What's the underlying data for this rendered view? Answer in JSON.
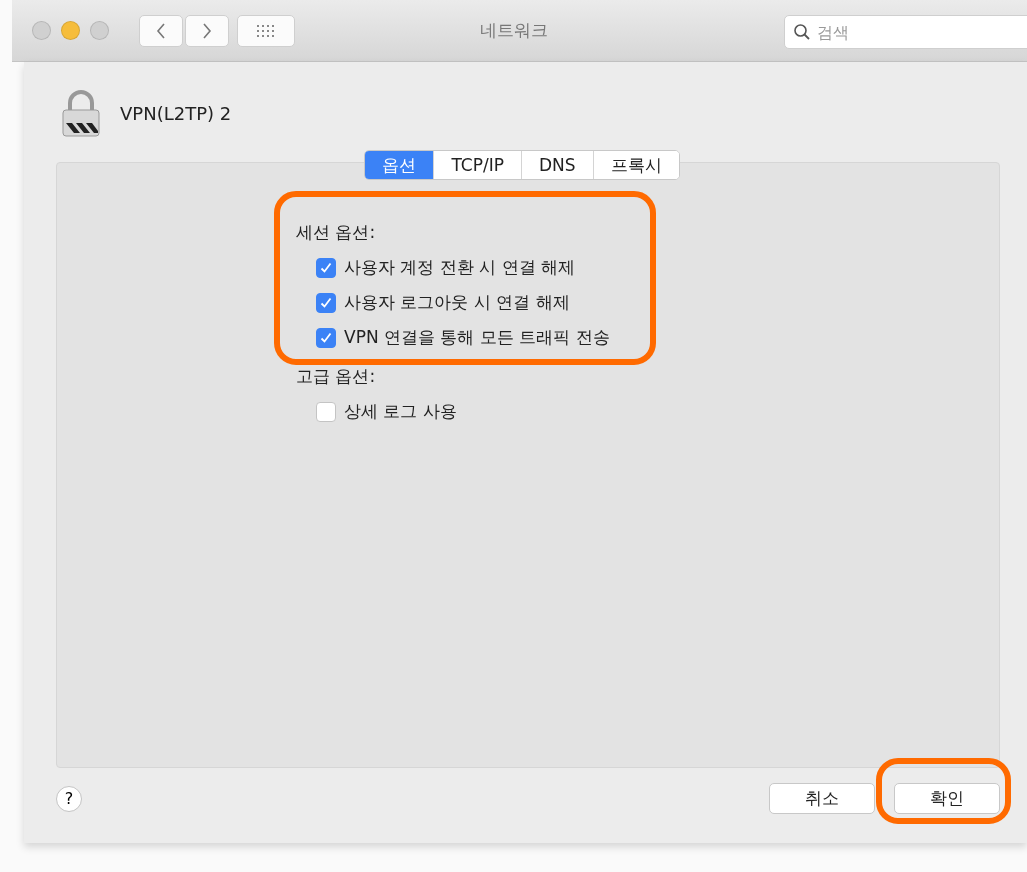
{
  "window": {
    "title": "네트워크"
  },
  "search": {
    "placeholder": "검색"
  },
  "connection": {
    "name": "VPN(L2TP) 2"
  },
  "tabs": [
    {
      "label": "옵션",
      "selected": true
    },
    {
      "label": "TCP/IP",
      "selected": false
    },
    {
      "label": "DNS",
      "selected": false
    },
    {
      "label": "프록시",
      "selected": false
    }
  ],
  "sections": [
    {
      "title": "세션 옵션:",
      "highlighted": true,
      "options": [
        {
          "label": "사용자 계정 전환 시 연결 해제",
          "checked": true
        },
        {
          "label": "사용자 로그아웃 시 연결 해제",
          "checked": true
        },
        {
          "label": "VPN 연결을 통해 모든 트래픽 전송",
          "checked": true
        }
      ]
    },
    {
      "title": "고급 옵션:",
      "highlighted": false,
      "options": [
        {
          "label": "상세 로그 사용",
          "checked": false
        }
      ]
    }
  ],
  "help": {
    "label": "?"
  },
  "buttons": [
    {
      "label": "취소",
      "highlighted": false
    },
    {
      "label": "확인",
      "highlighted": true
    }
  ]
}
